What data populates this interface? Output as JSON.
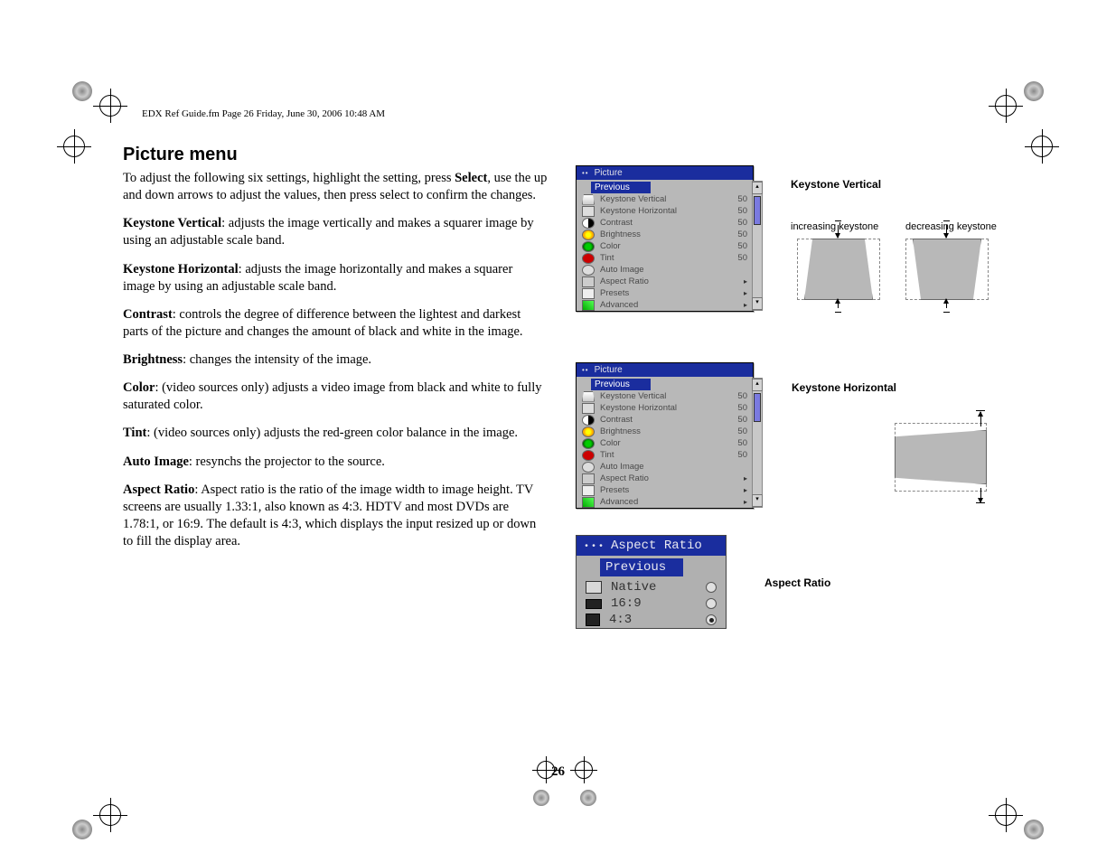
{
  "header": "EDX Ref Guide.fm  Page 26  Friday, June 30, 2006  10:48 AM",
  "title": "Picture menu",
  "paragraphs": {
    "intro_pre": "To adjust the following six settings, highlight the setting, press ",
    "intro_bold": "Select",
    "intro_post": ", use the up and down arrows to adjust the values, then press select to confirm the changes.",
    "kv_b": "Keystone Vertical",
    "kv_t": ": adjusts the image vertically and makes a squarer image by using an adjustable scale band.",
    "kh_b": "Keystone Horizontal",
    "kh_t": ": adjusts the image horizontally and makes a squarer image by using an adjustable scale band.",
    "con_b": "Contrast",
    "con_t": ": controls the degree of difference between the lightest and darkest parts of the picture and changes the amount of black and white in the image.",
    "bri_b": "Brightness",
    "bri_t": ": changes the intensity of the image.",
    "col_b": "Color",
    "col_t": ": (video sources only) adjusts a video image from black and white to fully saturated color.",
    "tin_b": "Tint",
    "tin_t": ": (video sources only) adjusts the red-green color balance in the image.",
    "ai_b": "Auto Image",
    "ai_t": ": resynchs the projector to the source.",
    "ar_b": "Aspect Ratio",
    "ar_t": ": Aspect ratio is the ratio of the image width to image height. TV screens are usually 1.33:1, also known as 4:3. HDTV and most DVDs are 1.78:1, or 16:9. The default is 4:3, which displays the input resized up or down to fill the display area."
  },
  "labels": {
    "kv": "Keystone Vertical",
    "inc": "increasing keystone",
    "dec": "decreasing keystone",
    "kh": "Keystone Horizontal",
    "ar": "Aspect Ratio"
  },
  "menu": {
    "title": "Picture",
    "previous": "Previous",
    "items": [
      {
        "label": "Keystone Vertical",
        "value": "50"
      },
      {
        "label": "Keystone Horizontal",
        "value": "50"
      },
      {
        "label": "Contrast",
        "value": "50"
      },
      {
        "label": "Brightness",
        "value": "50"
      },
      {
        "label": "Color",
        "value": "50"
      },
      {
        "label": "Tint",
        "value": "50"
      },
      {
        "label": "Auto Image",
        "value": ""
      },
      {
        "label": "Aspect Ratio",
        "value": "▸"
      },
      {
        "label": "Presets",
        "value": "▸"
      },
      {
        "label": "Advanced",
        "value": "▸"
      }
    ]
  },
  "aspect_menu": {
    "title": "Aspect Ratio",
    "previous": "Previous",
    "options": [
      {
        "label": "Native",
        "selected": false
      },
      {
        "label": "16:9",
        "selected": false
      },
      {
        "label": "4:3",
        "selected": true
      }
    ]
  },
  "page_number": "26"
}
